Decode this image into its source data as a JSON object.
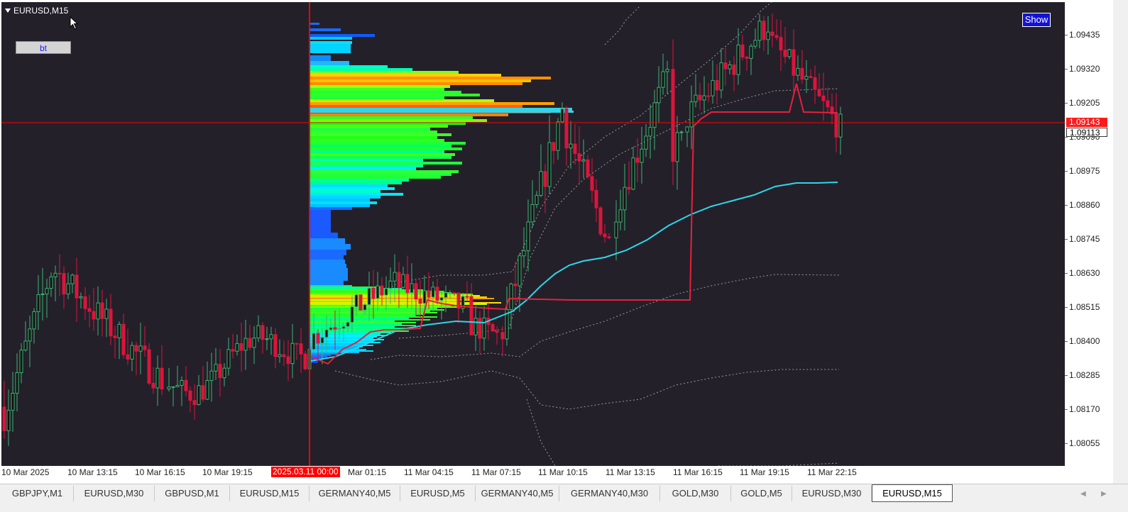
{
  "chart": {
    "title": "EURUSD,M15",
    "bt_button": "bt",
    "show_button": "Show",
    "current_price": "1.09143",
    "cursor_price": "1.09113"
  },
  "price_axis": {
    "ticks": [
      "1.09435",
      "1.09320",
      "1.09205",
      "1.09090",
      "1.08975",
      "1.08860",
      "1.08745",
      "1.08630",
      "1.08515",
      "1.08400",
      "1.08285",
      "1.08170",
      "1.08055"
    ]
  },
  "time_axis": {
    "labels": [
      "10 Mar 2025",
      "10 Mar 13:15",
      "10 Mar 16:15",
      "10 Mar 19:15",
      "Mar 01:15",
      "11 Mar 04:15",
      "11 Mar 07:15",
      "11 Mar 10:15",
      "11 Mar 13:15",
      "11 Mar 16:15",
      "11 Mar 19:15",
      "11 Mar 22:15"
    ],
    "marker": "2025.03.11 00:00"
  },
  "tabs": [
    "GBPJPY,M1",
    "EURUSD,M30",
    "GBPUSD,M1",
    "EURUSD,M15",
    "GERMANY40,M5",
    "EURUSD,M5",
    "GERMANY40,M5",
    "GERMANY40,M30",
    "GOLD,M30",
    "GOLD,M5",
    "EURUSD,M30",
    "EURUSD,M15"
  ],
  "active_tab": "EURUSD,M15",
  "colors": {
    "background": "#23202a",
    "bull": "#3cb371",
    "bear": "#dc143c",
    "ma": "#2fd6e8",
    "vwap": "#e8203c",
    "crosshair": "#ff0000"
  },
  "chart_data": {
    "type": "candlestick",
    "symbol": "EURUSD",
    "timeframe": "M15",
    "ylim": [
      1.08,
      1.0955
    ],
    "candles_approx": [
      {
        "t": "10 Mar 10:00",
        "o": 1.0817,
        "c": 1.0815,
        "h": 1.0821,
        "l": 1.081
      },
      {
        "t": "10 Mar 11:00",
        "o": 1.0818,
        "c": 1.0845,
        "h": 1.085,
        "l": 1.0814
      },
      {
        "t": "10 Mar 12:00",
        "o": 1.0845,
        "c": 1.086,
        "h": 1.0873,
        "l": 1.084
      },
      {
        "t": "10 Mar 13:00",
        "o": 1.086,
        "c": 1.0848,
        "h": 1.0868,
        "l": 1.0815
      },
      {
        "t": "10 Mar 14:00",
        "o": 1.0848,
        "c": 1.0852,
        "h": 1.0858,
        "l": 1.0838
      },
      {
        "t": "10 Mar 15:00",
        "o": 1.0852,
        "c": 1.084,
        "h": 1.0856,
        "l": 1.0832
      },
      {
        "t": "10 Mar 16:00",
        "o": 1.084,
        "c": 1.0835,
        "h": 1.0848,
        "l": 1.0826
      },
      {
        "t": "10 Mar 17:00",
        "o": 1.0835,
        "c": 1.083,
        "h": 1.0841,
        "l": 1.0822
      },
      {
        "t": "10 Mar 18:00",
        "o": 1.083,
        "c": 1.0836,
        "h": 1.0846,
        "l": 1.0826
      },
      {
        "t": "10 Mar 19:00",
        "o": 1.0836,
        "c": 1.0828,
        "h": 1.0841,
        "l": 1.0819
      },
      {
        "t": "10 Mar 20:00",
        "o": 1.0828,
        "c": 1.082,
        "h": 1.0834,
        "l": 1.0816
      },
      {
        "t": "10 Mar 21:00",
        "o": 1.082,
        "c": 1.0832,
        "h": 1.0836,
        "l": 1.0818
      },
      {
        "t": "10 Mar 22:00",
        "o": 1.0832,
        "c": 1.0834,
        "h": 1.0838,
        "l": 1.0826
      },
      {
        "t": "10 Mar 23:00",
        "o": 1.0834,
        "c": 1.0838,
        "h": 1.0841,
        "l": 1.083
      },
      {
        "t": "11 Mar 01:00",
        "o": 1.0838,
        "c": 1.0845,
        "h": 1.085,
        "l": 1.0836
      },
      {
        "t": "11 Mar 02:00",
        "o": 1.0845,
        "c": 1.0854,
        "h": 1.086,
        "l": 1.0842
      },
      {
        "t": "11 Mar 03:00",
        "o": 1.0854,
        "c": 1.0856,
        "h": 1.0861,
        "l": 1.0848
      },
      {
        "t": "11 Mar 04:00",
        "o": 1.0856,
        "c": 1.0851,
        "h": 1.086,
        "l": 1.0847
      },
      {
        "t": "11 Mar 05:00",
        "o": 1.0851,
        "c": 1.085,
        "h": 1.0856,
        "l": 1.0845
      },
      {
        "t": "11 Mar 06:00",
        "o": 1.085,
        "c": 1.084,
        "h": 1.0853,
        "l": 1.0837
      },
      {
        "t": "11 Mar 07:00",
        "o": 1.084,
        "c": 1.0865,
        "h": 1.0872,
        "l": 1.0837
      },
      {
        "t": "11 Mar 08:00",
        "o": 1.0865,
        "c": 1.089,
        "h": 1.0896,
        "l": 1.0862
      },
      {
        "t": "11 Mar 09:00",
        "o": 1.089,
        "c": 1.0915,
        "h": 1.0921,
        "l": 1.0885
      },
      {
        "t": "11 Mar 10:00",
        "o": 1.0915,
        "c": 1.0895,
        "h": 1.092,
        "l": 1.0885
      },
      {
        "t": "11 Mar 11:00",
        "o": 1.0895,
        "c": 1.088,
        "h": 1.09,
        "l": 1.0873
      },
      {
        "t": "11 Mar 12:00",
        "o": 1.088,
        "c": 1.089,
        "h": 1.0897,
        "l": 1.0875
      },
      {
        "t": "11 Mar 13:00",
        "o": 1.089,
        "c": 1.0915,
        "h": 1.092,
        "l": 1.0887
      },
      {
        "t": "11 Mar 14:00",
        "o": 1.0915,
        "c": 1.0928,
        "h": 1.0935,
        "l": 1.091
      },
      {
        "t": "11 Mar 15:00",
        "o": 1.0928,
        "c": 1.0905,
        "h": 1.0932,
        "l": 1.0896
      },
      {
        "t": "11 Mar 16:00",
        "o": 1.0905,
        "c": 1.0918,
        "h": 1.0925,
        "l": 1.09
      },
      {
        "t": "11 Mar 17:00",
        "o": 1.0918,
        "c": 1.093,
        "h": 1.0938,
        "l": 1.0914
      },
      {
        "t": "11 Mar 18:00",
        "o": 1.093,
        "c": 1.094,
        "h": 1.0946,
        "l": 1.0926
      },
      {
        "t": "11 Mar 19:00",
        "o": 1.094,
        "c": 1.0946,
        "h": 1.095,
        "l": 1.093
      },
      {
        "t": "11 Mar 20:00",
        "o": 1.0946,
        "c": 1.0925,
        "h": 1.095,
        "l": 1.092
      },
      {
        "t": "11 Mar 21:00",
        "o": 1.0925,
        "c": 1.0915,
        "h": 1.093,
        "l": 1.0906
      },
      {
        "t": "11 Mar 22:00",
        "o": 1.0915,
        "c": 1.0911,
        "h": 1.0922,
        "l": 1.0905
      }
    ]
  }
}
